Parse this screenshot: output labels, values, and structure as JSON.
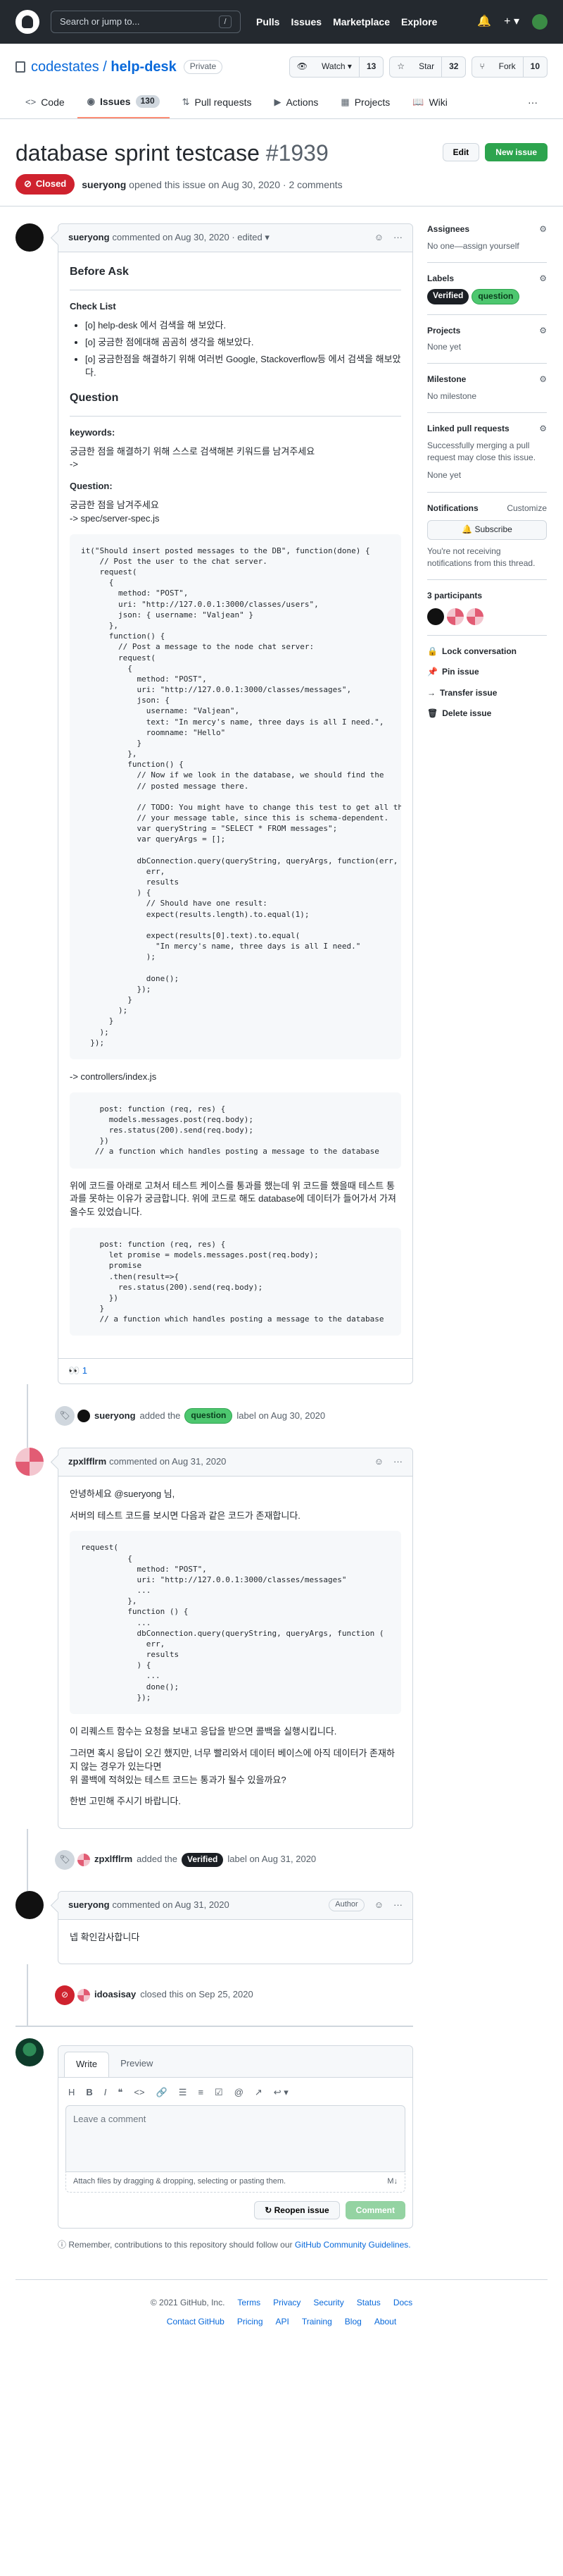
{
  "header": {
    "search_placeholder": "Search or jump to...",
    "search_key": "/",
    "nav": [
      "Pulls",
      "Issues",
      "Marketplace",
      "Explore"
    ]
  },
  "repo": {
    "owner": "codestates",
    "sep": "/",
    "name": "help-desk",
    "visibility": "Private",
    "watch_label": "Watch ▾",
    "watch_count": "13",
    "star_label": "Star",
    "star_count": "32",
    "fork_label": "Fork",
    "fork_count": "10",
    "tabs": {
      "code": "Code",
      "issues": "Issues",
      "issues_count": "130",
      "pulls": "Pull requests",
      "actions": "Actions",
      "projects": "Projects",
      "wiki": "Wiki",
      "more": "···"
    }
  },
  "issue": {
    "title": "database sprint testcase",
    "number": "#1939",
    "edit_label": "Edit",
    "new_issue_label": "New issue",
    "state": "Closed",
    "author": "sueryong",
    "meta_text": "opened this issue on Aug 30, 2020 · 2 comments"
  },
  "comment1": {
    "author": "sueryong",
    "meta": "commented on Aug 30, 2020 · edited ▾",
    "heading": "Before Ask",
    "checklist_title": "Check List",
    "checklist": [
      "[o] help-desk 에서 검색을 해 보았다.",
      "[o] 궁금한 점에대해 곰곰히 생각을 해보았다.",
      "[o] 궁금한점을 해결하기 위해 여러번 Google, Stackoverflow등 에서 검색을 해보았다."
    ],
    "question_heading": "Question",
    "keywords_title": "keywords:",
    "keywords_text": "궁금한 점을 해결하기 위해 스스로 검색해본 키워드를 남겨주세요\n->",
    "question_title": "Question:",
    "question_text": "궁금한 점을 남겨주세요\n-> spec/server-spec.js",
    "code1": "it(\"Should insert posted messages to the DB\", function(done) {\n    // Post the user to the chat server.\n    request(\n      {\n        method: \"POST\",\n        uri: \"http://127.0.0.1:3000/classes/users\",\n        json: { username: \"Valjean\" }\n      },\n      function() {\n        // Post a message to the node chat server:\n        request(\n          {\n            method: \"POST\",\n            uri: \"http://127.0.0.1:3000/classes/messages\",\n            json: {\n              username: \"Valjean\",\n              text: \"In mercy's name, three days is all I need.\",\n              roomname: \"Hello\"\n            }\n          },\n          function() {\n            // Now if we look in the database, we should find the\n            // posted message there.\n\n            // TODO: You might have to change this test to get all the data from\n            // your message table, since this is schema-dependent.\n            var queryString = \"SELECT * FROM messages\";\n            var queryArgs = [];\n\n            dbConnection.query(queryString, queryArgs, function(err, results) {\n              err,\n              results\n            ) {\n              // Should have one result:\n              expect(results.length).to.equal(1);\n\n              expect(results[0].text).to.equal(\n                \"In mercy's name, three days is all I need.\"\n              );\n\n              done();\n            });\n          }\n        );\n      }\n    );\n  });",
    "controllers_text": "-> controllers/index.js",
    "code2": "    post: function (req, res) {\n      models.messages.post(req.body);\n      res.status(200).send(req.body);\n    })\n   // a function which handles posting a message to the database",
    "explain_text": "위에 코드를 아래로 고쳐서 테스트 케이스를 통과를 했는데 위 코드를 했을때 테스트 통과를 못하는 이유가 궁금합니다. 위에 코드로 해도 database에 데이터가 들어가서 가져올수도 있었습니다.",
    "code3": "    post: function (req, res) {\n      let promise = models.messages.post(req.body);\n      promise\n      .then(result=>{\n        res.status(200).send(req.body);\n      })\n    }\n    // a function which handles posting a message to the database",
    "reaction": "👀 1"
  },
  "event1": {
    "actor": "sueryong",
    "text_before": "added the",
    "label": "question",
    "text_after": "label on Aug 30, 2020"
  },
  "comment2": {
    "author": "zpxlfflrm",
    "meta": "commented on Aug 31, 2020",
    "greeting": "안녕하세요 @sueryong 님,",
    "intro": "서버의 테스트 코드를 보시면 다음과 같은 코드가 존재합니다.",
    "code": "request(\n          {\n            method: \"POST\",\n            uri: \"http://127.0.0.1:3000/classes/messages\"\n            ...\n          },\n          function () {\n            ...\n            dbConnection.query(queryString, queryArgs, function (\n              err,\n              results\n            ) {\n              ...\n              done();\n            });",
    "para1": "이 리퀘스트 함수는 요청을 보내고 응답을 받으면 콜백을 실행시킵니다.",
    "para2": "그러면 혹시 응답이 오긴 했지만, 너무 빨리와서 데이터 베이스에 아직 데이터가 존재하지 않는 경우가 있는다면\n위 콜백에 적혀있는 테스트 코드는 통과가 될수 있을까요?",
    "para3": "한번 고민해 주시기 바랍니다."
  },
  "event2": {
    "actor": "zpxlfflrm",
    "text_before": "added the",
    "label": "Verified",
    "text_after": "label on Aug 31, 2020"
  },
  "comment3": {
    "author": "sueryong",
    "meta": "commented on Aug 31, 2020",
    "badge": "Author",
    "body": "넵 확인감사합니다"
  },
  "event3": {
    "actor": "idoasisay",
    "text": "closed this on Sep 25, 2020"
  },
  "compose": {
    "tab_write": "Write",
    "tab_preview": "Preview",
    "placeholder": "Leave a comment",
    "attach_text": "Attach files by dragging & dropping, selecting or pasting them.",
    "md_icon": "M↓",
    "reopen_label": "Reopen issue",
    "comment_label": "Comment",
    "remember_text": "Remember, contributions to this repository should follow our",
    "guidelines_link": "GitHub Community Guidelines."
  },
  "sidebar": {
    "assignees_title": "Assignees",
    "assignees_value": "No one—assign yourself",
    "labels_title": "Labels",
    "label1": "Verified",
    "label2": "question",
    "projects_title": "Projects",
    "projects_value": "None yet",
    "milestone_title": "Milestone",
    "milestone_value": "No milestone",
    "linked_title": "Linked pull requests",
    "linked_desc": "Successfully merging a pull request may close this issue.",
    "linked_value": "None yet",
    "notifications_title": "Notifications",
    "customize": "Customize",
    "subscribe_label": "Subscribe",
    "notify_desc": "You're not receiving notifications from this thread.",
    "participants_title": "3 participants",
    "lock": "Lock conversation",
    "pin": "Pin issue",
    "transfer": "Transfer issue",
    "delete": "Delete issue"
  },
  "footer": {
    "copyright": "© 2021 GitHub, Inc.",
    "links1": [
      "Terms",
      "Privacy",
      "Security",
      "Status",
      "Docs"
    ],
    "links2": [
      "Contact GitHub",
      "Pricing",
      "API",
      "Training",
      "Blog",
      "About"
    ]
  },
  "colors": {
    "header_bg": "#24292f",
    "closed_red": "#cf222e",
    "primary_green": "#2da44e",
    "link_blue": "#0969da"
  }
}
